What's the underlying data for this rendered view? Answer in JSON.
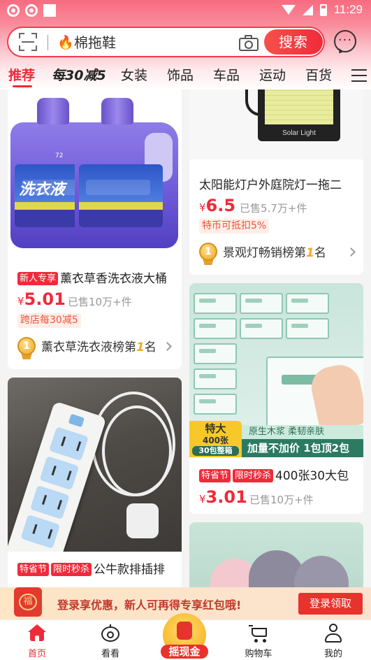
{
  "status_bar": {
    "time": "11:29"
  },
  "search": {
    "query": "棉拖鞋",
    "button_label": "搜索"
  },
  "categories": [
    {
      "label": "推荐"
    },
    {
      "label": "每30减5"
    },
    {
      "label": "女装"
    },
    {
      "label": "饰品"
    },
    {
      "label": "车品"
    },
    {
      "label": "运动"
    },
    {
      "label": "百货"
    }
  ],
  "products": [
    {
      "tags": [
        "新人专享"
      ],
      "title": "薰衣草香洗衣液大桶",
      "currency": "¥",
      "price": "5.01",
      "sold": "已售10万+件",
      "promo": "跨店每30减5",
      "rank": {
        "prefix": "薰衣草洗衣液榜第",
        "number": "1",
        "suffix": "名"
      },
      "image_text": {
        "brand": "洗衣液",
        "volume": "72"
      }
    },
    {
      "tags": [],
      "title": "太阳能灯户外庭院灯一拖二",
      "currency": "¥",
      "price": "6.5",
      "sold": "已售5.7万+件",
      "promo": "特币可抵扣5%",
      "rank": {
        "prefix": "景观灯畅销榜第",
        "number": "1",
        "suffix": "名"
      },
      "image_text": {
        "brand": "Solar Light"
      }
    },
    {
      "tags": [
        "特省节",
        "限时秒杀"
      ],
      "title": "400张30大包",
      "currency": "¥",
      "price": "3.01",
      "sold": "已售10万+件",
      "image_text": {
        "badge_line1": "特大",
        "badge_line2": "400张",
        "badge_line3": "30包整箱",
        "strip1": "原生木浆 柔韧亲肤",
        "strip2": "加量不加价 1包顶2包"
      }
    },
    {
      "tags": [
        "特省节",
        "限时秒杀"
      ],
      "title": "公牛款排插排"
    }
  ],
  "login_banner": {
    "icon_text": "福",
    "text": "登录享优惠，新人可再得专享红包哦!",
    "button_label": "登录领取"
  },
  "bottom_nav": [
    {
      "label": "首页",
      "icon": "home-icon",
      "active": true
    },
    {
      "label": "看看",
      "icon": "eye-icon"
    },
    {
      "label": "摇现金",
      "icon": "money-bag-icon"
    },
    {
      "label": "购物车",
      "icon": "cart-icon"
    },
    {
      "label": "我的",
      "icon": "user-icon"
    }
  ],
  "colors": {
    "accent": "#f02a3a",
    "header_top": "#f76b7f",
    "banner_bg": "#fde5c5"
  }
}
